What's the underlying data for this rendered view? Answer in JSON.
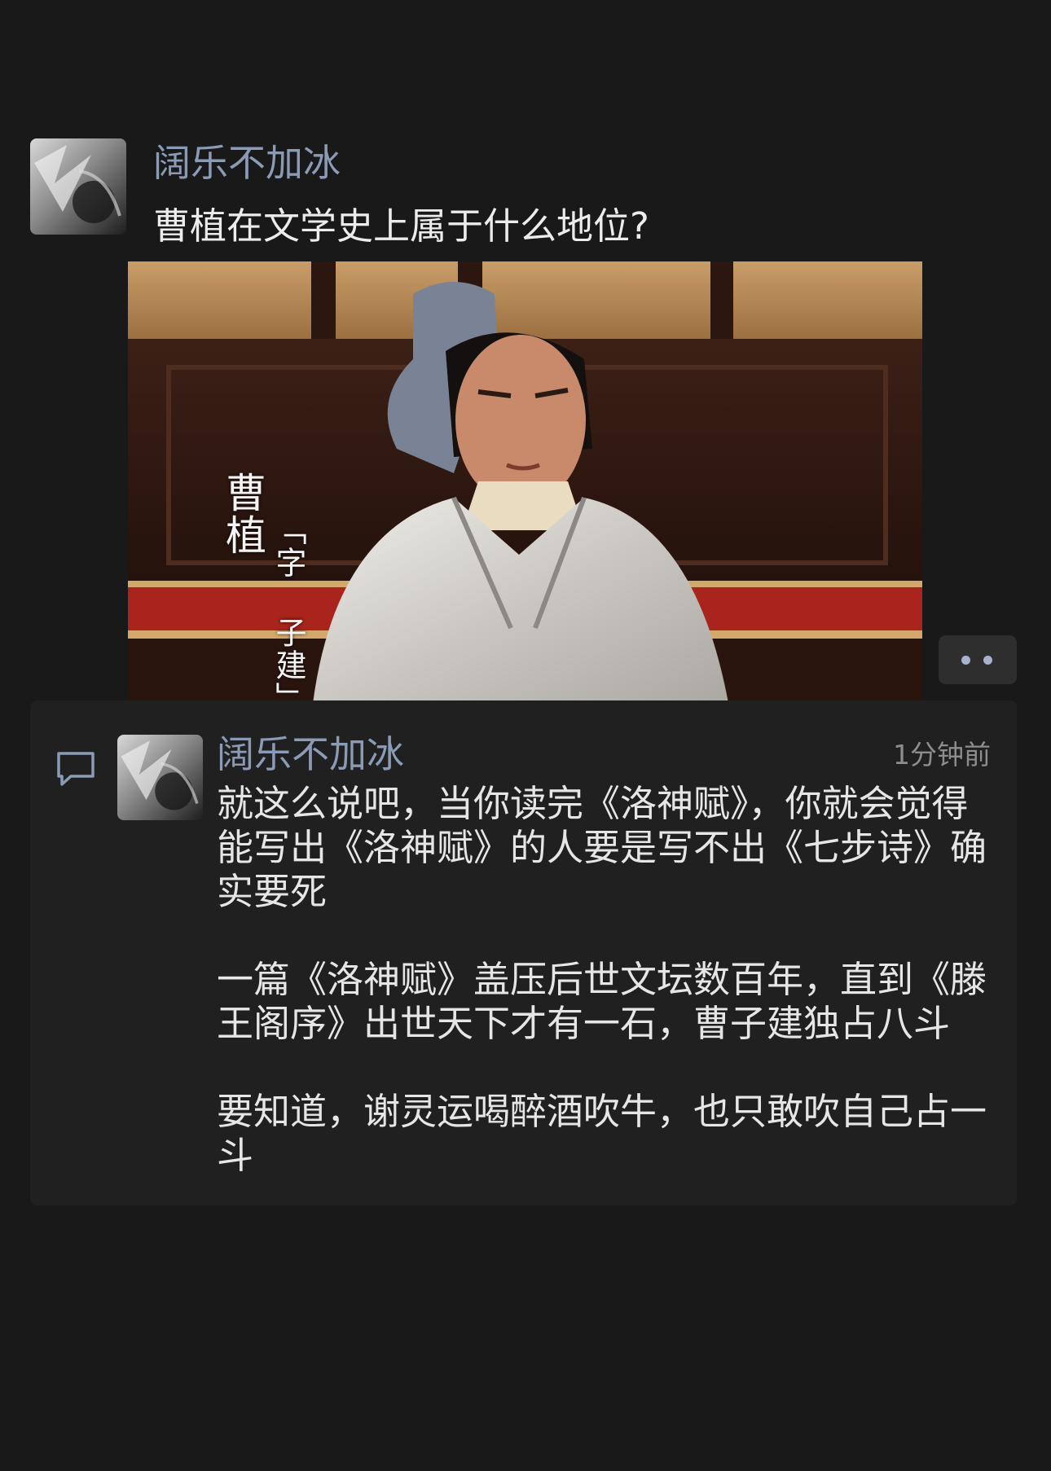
{
  "post": {
    "author": "阔乐不加冰",
    "text": "曹植在文学史上属于什么地位?",
    "image": {
      "caption_name": "曹植",
      "caption_zi": "「字 子建」"
    }
  },
  "more_button": {
    "icon": "more-dots-icon"
  },
  "comment": {
    "icon": "comment-icon",
    "author": "阔乐不加冰",
    "time": "1分钟前",
    "paragraphs": [
      "就这么说吧，当你读完《洛神赋》，你就会觉得\n能写出《洛神赋》的人要是写不出《七步诗》确\n实要死",
      "一篇《洛神赋》盖压后世文坛数百年，直到《滕\n王阁序》出世天下才有一石，曹子建独占八斗",
      "要知道，谢灵运喝醉酒吹牛，也只敢吹自己占一\n斗"
    ]
  },
  "colors": {
    "background": "#191919",
    "panel": "#202020",
    "name_link": "#8b9ab5",
    "time": "#8d8d8d"
  }
}
